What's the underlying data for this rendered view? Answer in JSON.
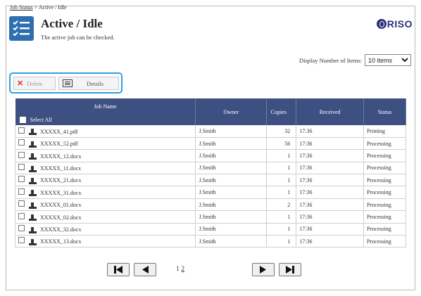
{
  "breadcrumb": {
    "link": "Job Status",
    "separator": " > ",
    "current": "Active / Idle"
  },
  "header": {
    "title": "Active / Idle",
    "subtitle": "The active job can be checked.",
    "logo": "RISO"
  },
  "display": {
    "label": "Display Number of Items:",
    "selected": "10 items"
  },
  "toolbar": {
    "delete_label": "Delete",
    "details_label": "Details"
  },
  "table": {
    "headers": {
      "job_name": "Job Name",
      "owner": "Owner",
      "copies": "Copies",
      "received": "Received",
      "status": "Status"
    },
    "select_all": "Select All",
    "rows": [
      {
        "name": "XXXXX_41.pdf",
        "owner": "J.Smith",
        "copies": "32",
        "received": "17:36",
        "status": "Printing"
      },
      {
        "name": "XXXXX_52.pdf",
        "owner": "J.Smith",
        "copies": "56",
        "received": "17:36",
        "status": "Processing"
      },
      {
        "name": "XXXXX_12.docx",
        "owner": "J.Smith",
        "copies": "1",
        "received": "17:36",
        "status": "Processing"
      },
      {
        "name": "XXXXX_11.docx",
        "owner": "J.Smith",
        "copies": "1",
        "received": "17:36",
        "status": "Processing"
      },
      {
        "name": "XXXXX_21.docx",
        "owner": "J.Smith",
        "copies": "1",
        "received": "17:36",
        "status": "Processing"
      },
      {
        "name": "XXXXX_31.docx",
        "owner": "J.Smith",
        "copies": "1",
        "received": "17:36",
        "status": "Processing"
      },
      {
        "name": "XXXXX_01.docx",
        "owner": "J.Smith",
        "copies": "2",
        "received": "17:36",
        "status": "Processing"
      },
      {
        "name": "XXXXX_02.docx",
        "owner": "J.Smith",
        "copies": "1",
        "received": "17:36",
        "status": "Processing"
      },
      {
        "name": "XXXXX_32.docx",
        "owner": "J.Smith",
        "copies": "1",
        "received": "17:36",
        "status": "Processing"
      },
      {
        "name": "XXXXX_13.docx",
        "owner": "J.Smith",
        "copies": "1",
        "received": "17:36",
        "status": "Processing"
      }
    ]
  },
  "pagination": {
    "current": "1",
    "next_page": "2"
  },
  "colors": {
    "header_bg": "#3d5081",
    "toolbar_highlight": "#2aa3dd",
    "title_icon": "#2f6fb0",
    "logo": "#2b2f78",
    "delete_x": "#e03020"
  },
  "icons": [
    "list-icon",
    "delete-x-icon",
    "details-icon",
    "printer-icon",
    "first-page-icon",
    "prev-page-icon",
    "next-page-icon",
    "last-page-icon"
  ]
}
